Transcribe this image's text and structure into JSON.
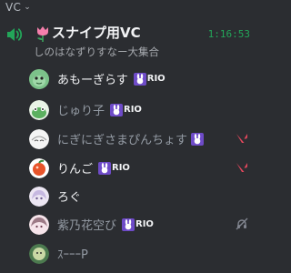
{
  "category": {
    "label": "VC"
  },
  "channel": {
    "name": "スナイプ用VC",
    "timer": "1:16:53",
    "status": "しのはなずりすなー大集合"
  },
  "users": [
    {
      "name": "あもーぎらす",
      "tag": "RIO",
      "right_icon": ""
    },
    {
      "name": "じゅり子",
      "tag": "RIO",
      "right_icon": ""
    },
    {
      "name": "にぎにぎさまぴんちょす",
      "tag": "",
      "right_icon": "valorant-icon"
    },
    {
      "name": "りんご",
      "tag": "RIO",
      "right_icon": "valorant-icon"
    },
    {
      "name": "ろぐ",
      "tag": "",
      "right_icon": ""
    },
    {
      "name": "紫乃花空び",
      "tag": "RIO",
      "right_icon": "deafened-icon"
    },
    {
      "name": "ｽｰｰｰP",
      "tag": "",
      "right_icon": ""
    }
  ],
  "colors": {
    "background": "#2b2d31",
    "speaker_green": "#23a559",
    "timer_green": "#23a559",
    "valorant_red": "#e3475c"
  }
}
